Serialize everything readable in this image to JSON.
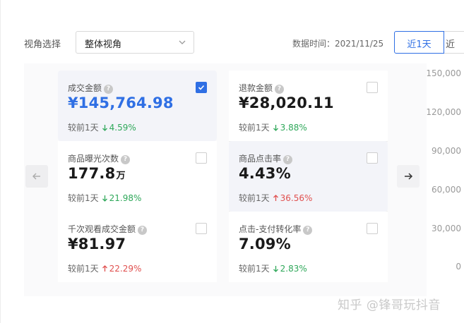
{
  "header": {
    "view_label": "视角选择",
    "view_select_value": "整体视角",
    "data_time": "数据时间：2021/11/25",
    "range_tabs": [
      "近1天",
      "近"
    ]
  },
  "metrics": [
    {
      "title": "成交金额",
      "value": "¥145,764.98",
      "unit": "",
      "compare_label": "较前1天",
      "direction": "down",
      "change": "4.59%",
      "checked": true
    },
    {
      "title": "退款金额",
      "value": "¥28,020.11",
      "unit": "",
      "compare_label": "较前1天",
      "direction": "down",
      "change": "3.88%",
      "checked": false
    },
    {
      "title": "商品曝光次数",
      "value": "177.8",
      "unit": "万",
      "compare_label": "较前1天",
      "direction": "down",
      "change": "21.98%",
      "checked": false
    },
    {
      "title": "商品点击率",
      "value": "4.43%",
      "unit": "",
      "compare_label": "较前1天",
      "direction": "up",
      "change": "36.56%",
      "checked": false
    },
    {
      "title": "千次观看成交金额",
      "value": "¥81.97",
      "unit": "",
      "compare_label": "较前1天",
      "direction": "up",
      "change": "22.29%",
      "checked": false
    },
    {
      "title": "点击-支付转化率",
      "value": "7.09%",
      "unit": "",
      "compare_label": "较前1天",
      "direction": "down",
      "change": "2.83%",
      "checked": false
    }
  ],
  "chart_axis": {
    "y_ticks": [
      "150,000",
      "120,000",
      "90,000",
      "60,000",
      "30,000",
      "0"
    ]
  },
  "watermark": "知乎 @锋哥玩抖音",
  "colors": {
    "accent": "#2f6fe4",
    "down": "#2fa85a",
    "up": "#e0504f"
  },
  "icons": {
    "help": "question-circle-icon",
    "down": "arrow-down-icon",
    "up": "arrow-up-icon",
    "prev": "arrow-left-icon",
    "next": "arrow-right-icon",
    "select": "chevron-down-icon"
  }
}
